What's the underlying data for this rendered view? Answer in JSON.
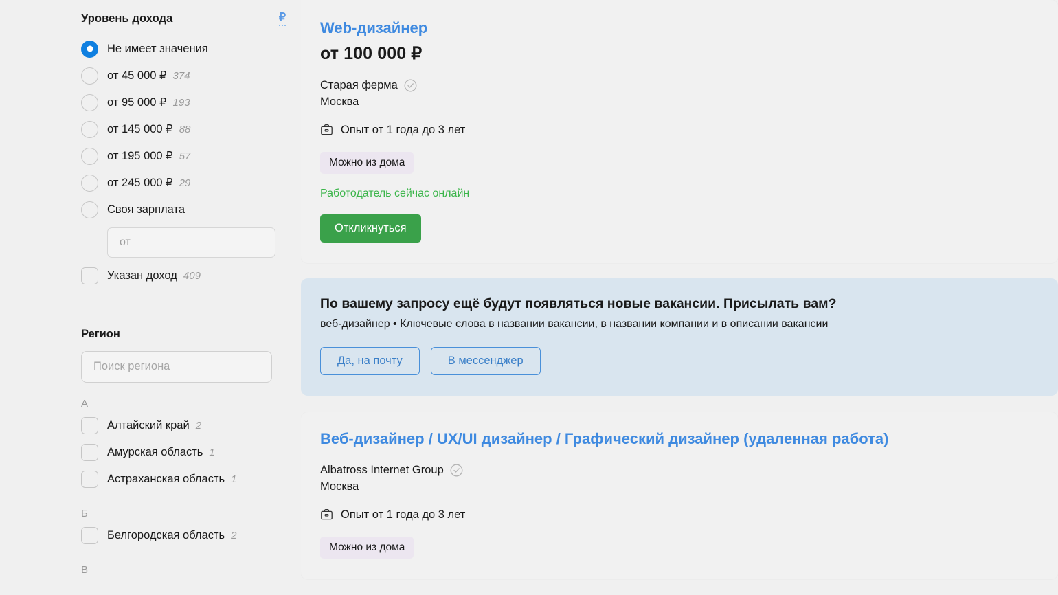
{
  "sidebar": {
    "income": {
      "title": "Уровень дохода",
      "currency_symbol": "₽",
      "options": [
        {
          "label": "Не имеет значения",
          "count": "",
          "selected": true
        },
        {
          "label": "от 45 000 ₽",
          "count": "374",
          "selected": false
        },
        {
          "label": "от 95 000 ₽",
          "count": "193",
          "selected": false
        },
        {
          "label": "от 145 000 ₽",
          "count": "88",
          "selected": false
        },
        {
          "label": "от 195 000 ₽",
          "count": "57",
          "selected": false
        },
        {
          "label": "от 245 000 ₽",
          "count": "29",
          "selected": false
        },
        {
          "label": "Своя зарплата",
          "count": "",
          "selected": false
        }
      ],
      "custom_salary_placeholder": "от",
      "custom_salary_value": "",
      "specified_income": {
        "label": "Указан доход",
        "count": "409",
        "checked": false
      }
    },
    "region": {
      "title": "Регион",
      "search_placeholder": "Поиск региона",
      "search_value": "",
      "groups": [
        {
          "letter": "А",
          "items": [
            {
              "label": "Алтайский край",
              "count": "2"
            },
            {
              "label": "Амурская область",
              "count": "1"
            },
            {
              "label": "Астраханская область",
              "count": "1"
            }
          ]
        },
        {
          "letter": "Б",
          "items": [
            {
              "label": "Белгородская область",
              "count": "2"
            }
          ]
        },
        {
          "letter": "В",
          "items": []
        }
      ]
    }
  },
  "main": {
    "job1": {
      "title": "Web-дизайнер",
      "salary": "от 100 000 ₽",
      "company": "Старая ферма",
      "city": "Москва",
      "experience": "Опыт от 1 года до 3 лет",
      "tag": "Можно из дома",
      "online_status": "Работодатель сейчас онлайн",
      "apply_label": "Откликнуться"
    },
    "banner": {
      "title": "По вашему запросу ещё будут появляться новые вакансии. Присылать вам?",
      "subtitle": "веб-дизайнер • Ключевые слова в названии вакансии, в названии компании и в описании вакансии",
      "email_label": "Да, на почту",
      "messenger_label": "В мессенджер"
    },
    "job2": {
      "title": "Веб-дизайнер / UX/UI дизайнер / Графический дизайнер (удаленная работа)",
      "company": "Albatross Internet Group",
      "city": "Москва",
      "experience": "Опыт от 1 года до 3 лет",
      "tag": "Можно из дома"
    }
  },
  "colors": {
    "accent_blue": "#3f8ae0",
    "radio_blue": "#0f7fe0",
    "apply_green": "#3aa14a",
    "online_green": "#3bb54a",
    "banner_bg": "#d9e5ef",
    "tag_bg": "#ece6f0",
    "page_bg": "#f0f0f0"
  }
}
